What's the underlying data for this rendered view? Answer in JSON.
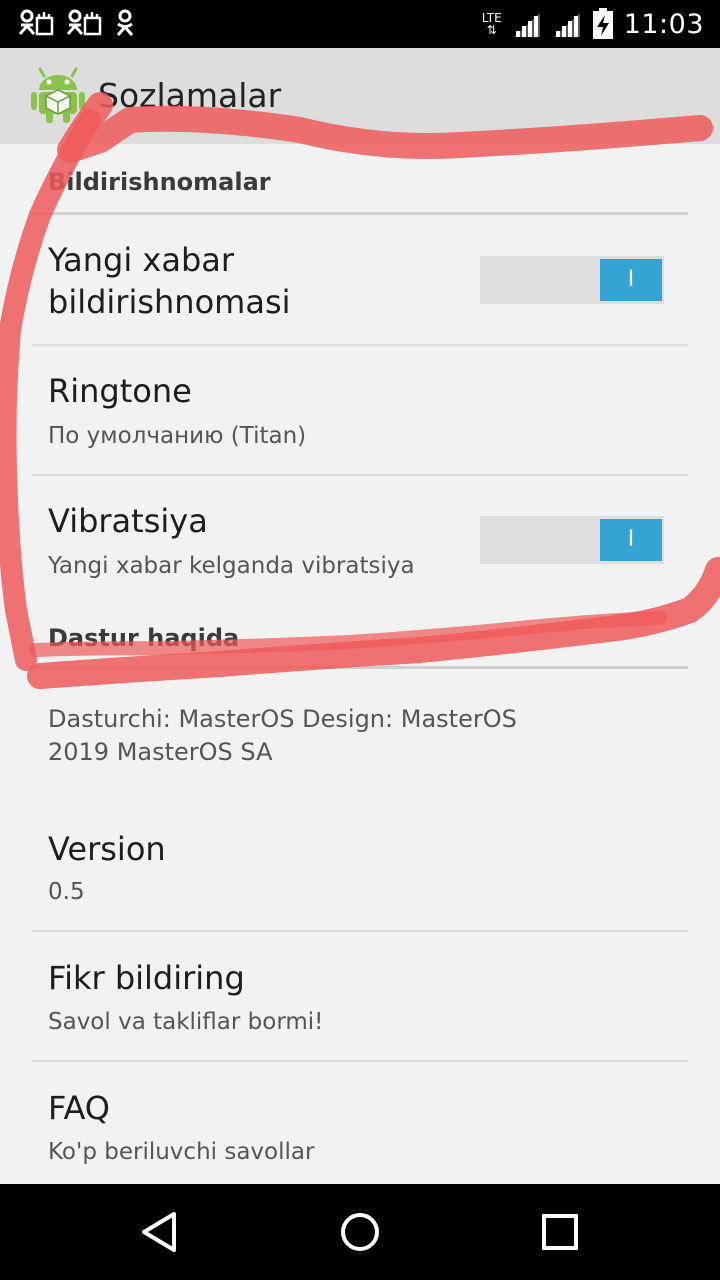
{
  "status_bar": {
    "time": "11:03",
    "network_type": "LTE",
    "icons": [
      "notification-icon",
      "notification-icon",
      "odnoklassniki-icon",
      "signal-icon",
      "signal-icon",
      "battery-charging-icon"
    ]
  },
  "action_bar": {
    "title": "Sozlamalar",
    "app_icon": "android-icon"
  },
  "sections": {
    "notifications": {
      "header": "Bildirishnomalar",
      "new_message": {
        "title_line1": "Yangi xabar",
        "title_line2": "bildirishnomasi",
        "toggle_state": "on",
        "toggle_label": "I"
      },
      "ringtone": {
        "title": "Ringtone",
        "summary": "По умолчанию (Titan)"
      },
      "vibration": {
        "title": "Vibratsiya",
        "summary": "Yangi xabar kelganda vibratsiya",
        "toggle_state": "on",
        "toggle_label": "I"
      }
    },
    "about": {
      "header": "Dastur haqida",
      "credits": {
        "line1": "Dasturchi: MasterOS Design: MasterOS",
        "line2": "2019 MasterOS SA"
      },
      "version": {
        "title": "Version",
        "summary": "0.5"
      },
      "feedback": {
        "title": "Fikr bildiring",
        "summary": "Savol va takliflar bormi!"
      },
      "faq": {
        "title": "FAQ",
        "summary": "Ko'p beriluvchi savollar"
      }
    }
  },
  "nav_bar": {
    "icons": [
      "back-icon",
      "home-icon",
      "recents-icon"
    ]
  },
  "colors": {
    "accent": "#33a4d3",
    "action_bar": "#dddddd",
    "background": "#f2f2f2",
    "scribble": "#f05a5a"
  }
}
